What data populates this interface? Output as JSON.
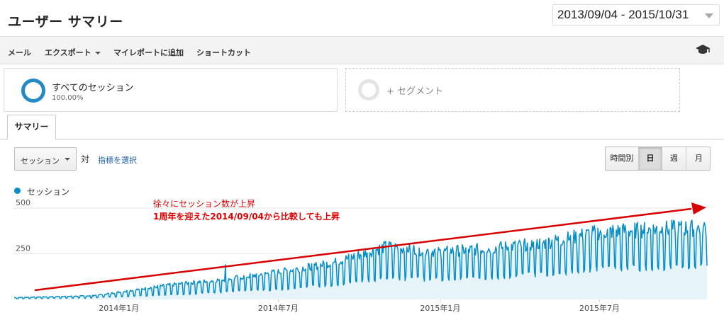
{
  "header": {
    "title": "ユーザー サマリー",
    "date_range": "2013/09/04 - 2015/10/31"
  },
  "toolbar": {
    "items": [
      "メール",
      "エクスポート",
      "マイレポートに追加",
      "ショートカット"
    ],
    "icon": "graduation-cap-icon"
  },
  "segments": {
    "active": {
      "name": "すべてのセッション",
      "percent": "100.00%"
    },
    "add_label": "+ セグメント"
  },
  "tabs": [
    "サマリー"
  ],
  "controls": {
    "metric_select": "セッション",
    "vs_label": "対",
    "select_metric_link": "指標を選択",
    "granularity": [
      {
        "label": "時間別",
        "active": false
      },
      {
        "label": "日",
        "active": true
      },
      {
        "label": "週",
        "active": false
      },
      {
        "label": "月",
        "active": false
      }
    ]
  },
  "colors": {
    "series": "#058dc7",
    "area": "#e6f4fa",
    "annotation": "#e00000"
  },
  "chart_data": {
    "type": "area",
    "series": [
      {
        "name": "セッション"
      }
    ],
    "x_range": [
      "2013-09-04",
      "2015-10-31"
    ],
    "x_tick_labels": [
      "2014年1月",
      "2014年7月",
      "2015年1月",
      "2015年7月"
    ],
    "y_ticks": [
      250,
      500
    ],
    "ylim": [
      0,
      500
    ],
    "weekly_profile": [
      {
        "from": "2013-09-04",
        "weekday": 10,
        "weekend": 4
      },
      {
        "from": "2013-12-01",
        "weekday": 20,
        "weekend": 8
      },
      {
        "from": "2014-01-01",
        "weekday": 40,
        "weekend": 15
      },
      {
        "from": "2014-03-01",
        "weekday": 80,
        "weekend": 25
      },
      {
        "from": "2014-05-01",
        "weekday": 110,
        "weekend": 40
      },
      {
        "from": "2014-07-01",
        "weekday": 150,
        "weekend": 55
      },
      {
        "from": "2014-09-01",
        "weekday": 200,
        "weekend": 80
      },
      {
        "from": "2014-11-01",
        "weekday": 290,
        "weekend": 120
      },
      {
        "from": "2015-01-01",
        "weekday": 260,
        "weekend": 110
      },
      {
        "from": "2015-03-01",
        "weekday": 280,
        "weekend": 120
      },
      {
        "from": "2015-05-01",
        "weekday": 310,
        "weekend": 140
      },
      {
        "from": "2015-07-01",
        "weekday": 370,
        "weekend": 170
      },
      {
        "from": "2015-10-01",
        "weekday": 390,
        "weekend": 180
      }
    ],
    "spikes": [
      {
        "date": "2014-05-02",
        "value": 190
      }
    ],
    "annotations": [
      "徐々にセッション数が上昇",
      "1周年を迎えた2014/09/04から比較しても上昇"
    ],
    "grid": true,
    "legend_position": "top-left"
  }
}
